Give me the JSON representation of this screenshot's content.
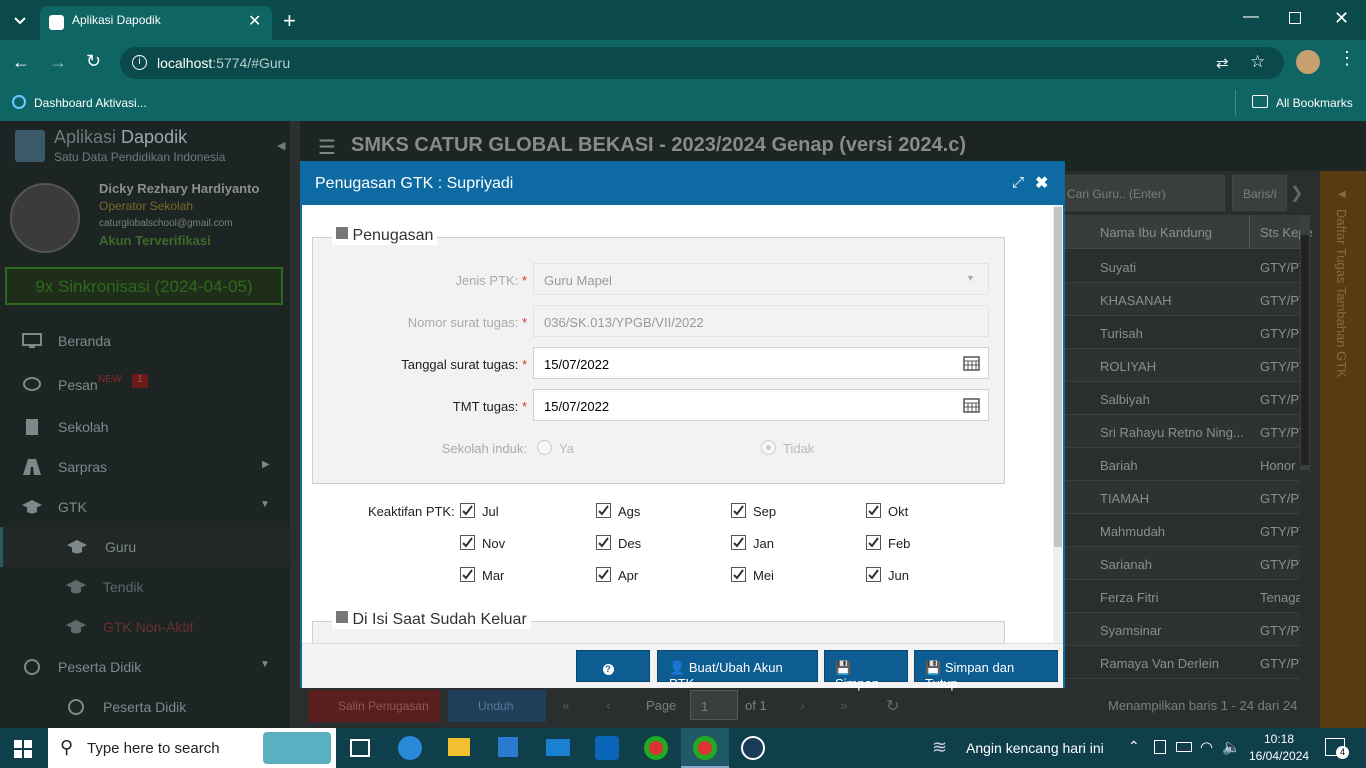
{
  "browser": {
    "tab_title": "Aplikasi Dapodik",
    "url_host": "localhost",
    "url_rest": ":5774/#Guru",
    "bookmark1": "Dashboard Aktivasi...",
    "bookmark_all": "All Bookmarks"
  },
  "app": {
    "title_a": "Aplikasi ",
    "title_b": "Dapodik",
    "subtitle": "Satu Data Pendidikan Indonesia",
    "school_title": "SMKS CATUR GLOBAL BEKASI - 2023/2024 Genap (versi 2024.c)"
  },
  "user": {
    "name": "Dicky Rezhary Hardiyanto",
    "role": "Operator Sekolah",
    "email": "caturglobalschool@gmail.com",
    "verified": "Akun Terverifikasi",
    "sync": "9x Sinkronisasi (2024-04-05)"
  },
  "nav": {
    "beranda": "Beranda",
    "pesan": "Pesan",
    "pesan_new": "NEW",
    "pesan_count": "1",
    "sekolah": "Sekolah",
    "sarpras": "Sarpras",
    "gtk": "GTK",
    "guru": "Guru",
    "tendik": "Tendik",
    "gtk_nonaktif": "GTK Non-Aktif",
    "peserta_didik": "Peserta Didik",
    "peserta_didik_sub": "Peserta Didik"
  },
  "grid": {
    "search_placeholder": "Cari Guru.. (Enter)",
    "baris": "Baris/I",
    "col_ibu": "Nama Ibu Kandung",
    "col_sts": "Sts Kepe",
    "rows": [
      [
        "Suyati",
        "GTY/PT"
      ],
      [
        "KHASANAH",
        "GTY/PT"
      ],
      [
        "Turisah",
        "GTY/PT"
      ],
      [
        "ROLIYAH",
        "GTY/PT"
      ],
      [
        "Salbiyah",
        "GTY/PT"
      ],
      [
        "Sri Rahayu Retno Ning...",
        "GTY/PT"
      ],
      [
        "Bariah",
        "Honor"
      ],
      [
        "TIAMAH",
        "GTY/PT"
      ],
      [
        "Mahmudah",
        "GTY/PT"
      ],
      [
        "Sarianah",
        "GTY/PT"
      ],
      [
        "Ferza Fitri",
        "Tenaga"
      ],
      [
        "Syamsinar",
        "GTY/PT"
      ],
      [
        "Ramaya Van Derlein",
        "GTY/PT"
      ]
    ],
    "side_panel": "Daftar Tugas Tambahan GTK",
    "salin": "Salin Penugasan",
    "unduh": "Unduh",
    "page_label": "Page",
    "page_value": "1",
    "of": "of 1",
    "showing": "Menampilkan baris 1 - 24 dari 24"
  },
  "dialog": {
    "title": "Penugasan GTK : Supriyadi",
    "legend": "Penugasan",
    "jenis_label": "Jenis PTK:",
    "jenis_value": "Guru Mapel",
    "nomor_label": "Nomor surat tugas:",
    "nomor_value": "036/SK.013/YPGB/VII/2022",
    "tanggal_label": "Tanggal surat tugas:",
    "tanggal_value": "15/07/2022",
    "tmt_label": "TMT tugas:",
    "tmt_value": "15/07/2022",
    "induk_label": "Sekolah induk:",
    "ya": "Ya",
    "tidak": "Tidak",
    "keaktifan_label": "Keaktifan PTK:",
    "months": [
      "Jul",
      "Ags",
      "Sep",
      "Okt",
      "Nov",
      "Des",
      "Jan",
      "Feb",
      "Mar",
      "Apr",
      "Mei",
      "Jun"
    ],
    "legend2": "Di Isi Saat Sudah Keluar",
    "help": "?",
    "btn_akun": "Buat/Ubah Akun PTK",
    "btn_simpan": "Simpan",
    "btn_simpan_tutup": "Simpan dan Tutup"
  },
  "taskbar": {
    "search": "Type here to search",
    "weather": "Angin kencang hari ini",
    "time": "10:18",
    "date": "16/04/2024",
    "notif": "4"
  }
}
